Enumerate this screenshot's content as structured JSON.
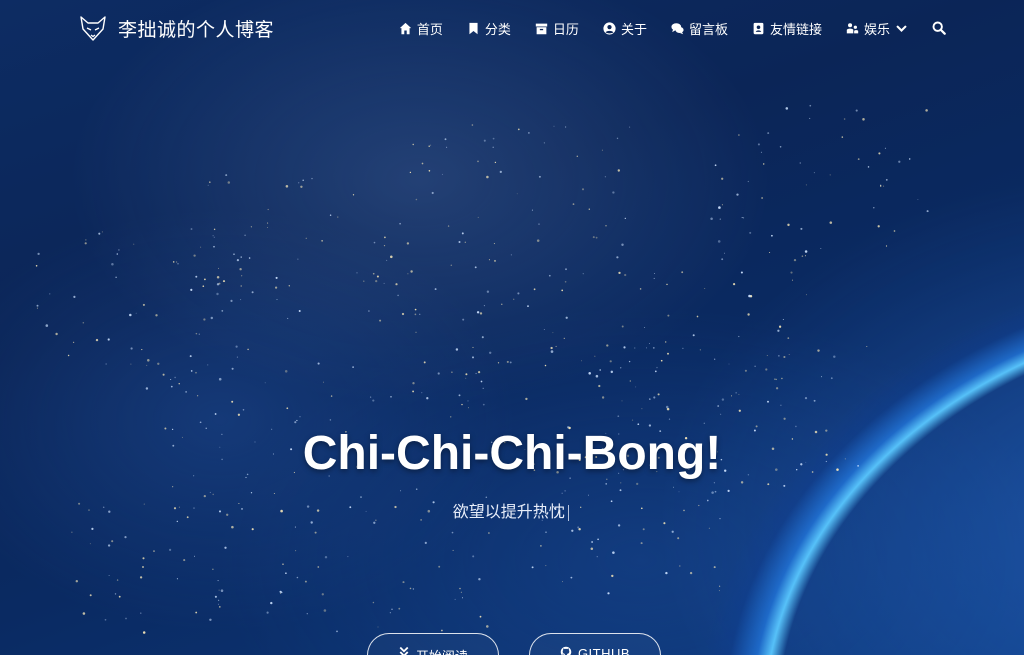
{
  "site": {
    "title": "李拙诚的个人博客",
    "logo_icon": "fox-logo-icon"
  },
  "nav": {
    "items": [
      {
        "label": "首页",
        "icon": "home-icon"
      },
      {
        "label": "分类",
        "icon": "bookmark-icon"
      },
      {
        "label": "日历",
        "icon": "archive-icon"
      },
      {
        "label": "关于",
        "icon": "user-circle-icon"
      },
      {
        "label": "留言板",
        "icon": "comments-icon"
      },
      {
        "label": "友情链接",
        "icon": "address-book-icon"
      },
      {
        "label": "娱乐",
        "icon": "user-group-icon",
        "dropdown_icon": "chevron-down-icon"
      }
    ],
    "search_icon": "search-icon"
  },
  "hero": {
    "title": "Chi-Chi-Chi-Bong!",
    "subtitle": "欲望以提升热忱",
    "cursor": "|",
    "buttons": [
      {
        "label": "开始阅读",
        "icon": "double-chevron-down-icon"
      },
      {
        "label": "GITHUB",
        "icon": "github-icon"
      }
    ]
  },
  "colors": {
    "background": "#0b2557",
    "accent_glow": "#5ac8ff",
    "text": "#ffffff"
  }
}
